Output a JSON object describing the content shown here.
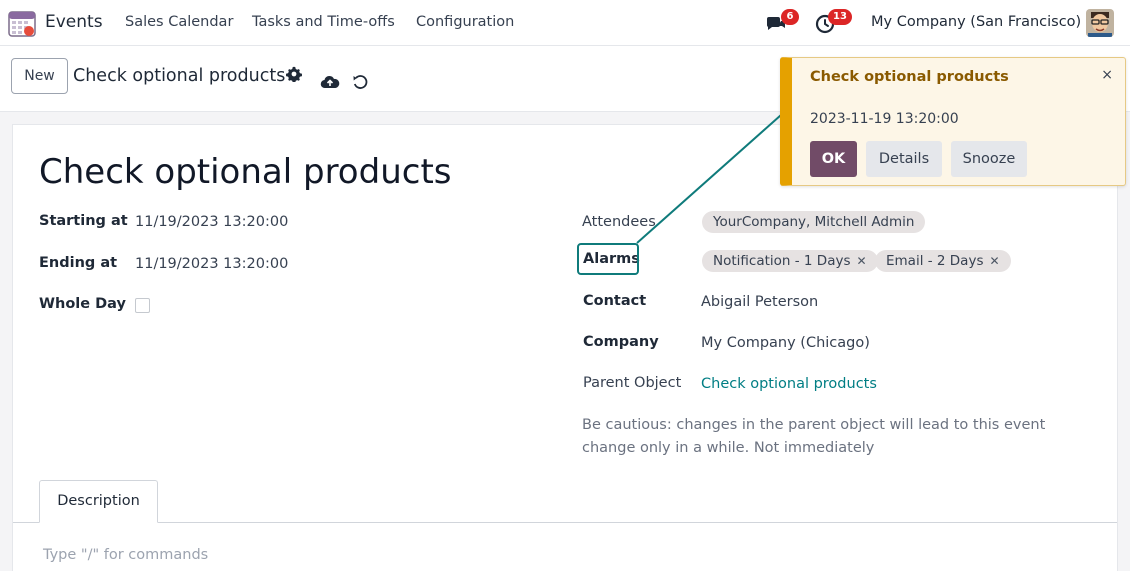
{
  "topbar": {
    "app_name": "Events",
    "menu": [
      "Sales Calendar",
      "Tasks and Time-offs",
      "Configuration"
    ],
    "messages_count": "6",
    "activities_count": "13",
    "company": "My Company (San Francisco)"
  },
  "controlbar": {
    "new_label": "New",
    "breadcrumb_title": "Check optional products"
  },
  "form": {
    "title": "Check optional products",
    "starting_at_label": "Starting at",
    "starting_at_value": "11/19/2023 13:20:00",
    "ending_at_label": "Ending at",
    "ending_at_value": "11/19/2023 13:20:00",
    "whole_day_label": "Whole Day",
    "attendees_label": "Attendees",
    "attendees": [
      "YourCompany, Mitchell Admin"
    ],
    "alarms_label": "Alarms",
    "alarms": [
      "Notification - 1 Days",
      "Email - 2 Days"
    ],
    "contact_label": "Contact",
    "contact_value": "Abigail Peterson",
    "company_label": "Company",
    "company_value": "My Company (Chicago)",
    "parent_object_label": "Parent Object",
    "parent_object_value": "Check optional products",
    "note": "Be cautious: changes in the parent object will lead to this event change only in a while. Not immediately"
  },
  "tabs": {
    "description_label": "Description",
    "editor_placeholder": "Type \"/\" for commands"
  },
  "notification": {
    "title": "Check optional products",
    "close": "×",
    "datetime": "2023-11-19 13:20:00",
    "ok_label": "OK",
    "details_label": "Details",
    "snooze_label": "Snooze"
  },
  "colors": {
    "brand": "#714b67",
    "link": "#017e84",
    "badge": "#dc2626",
    "notification_accent": "#e5a100",
    "highlight": "#0f7b7b"
  }
}
